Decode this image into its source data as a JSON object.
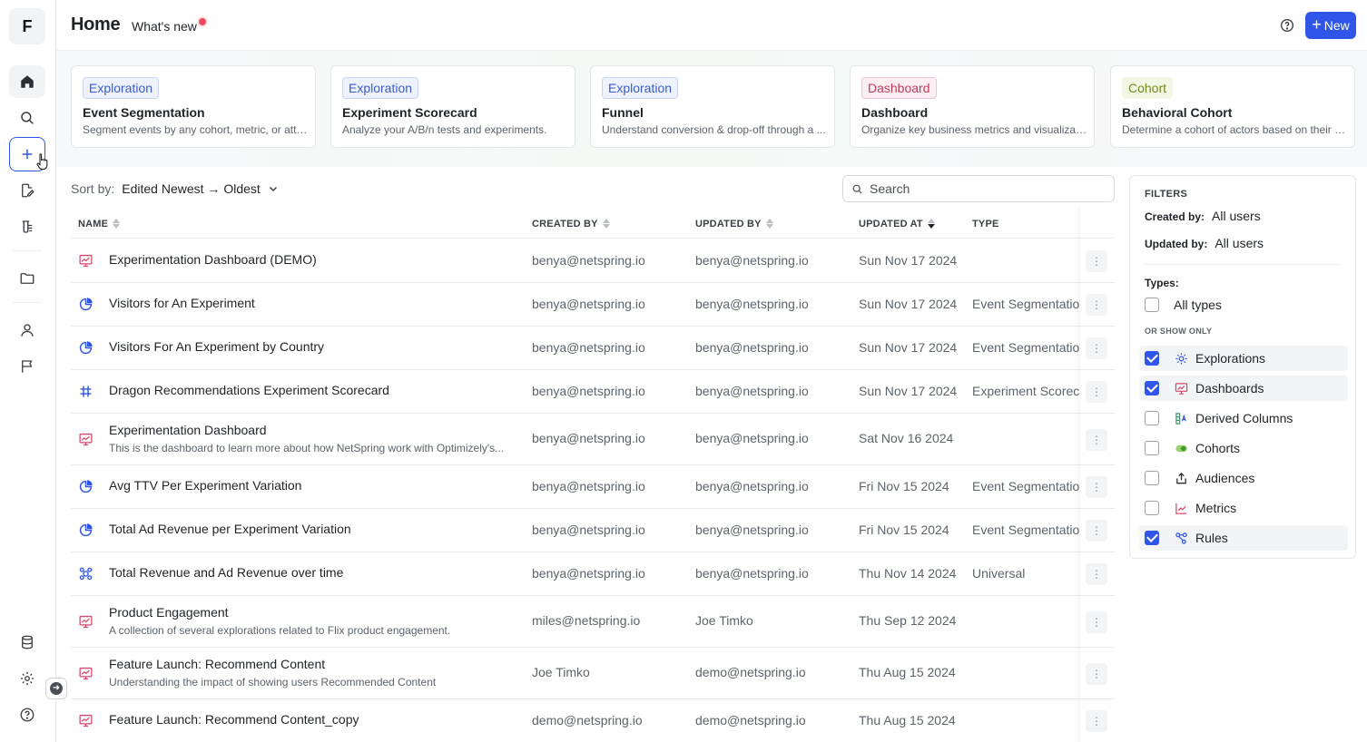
{
  "rail": {
    "logo": "F",
    "items": [
      {
        "name": "home-icon"
      },
      {
        "name": "search-icon"
      },
      {
        "name": "plus-icon"
      },
      {
        "name": "edit-doc-icon"
      },
      {
        "name": "flask-icon"
      },
      {
        "name": "folder-icon"
      },
      {
        "name": "user-icon"
      },
      {
        "name": "flag-icon"
      },
      {
        "name": "database-icon"
      },
      {
        "name": "gear-icon"
      },
      {
        "name": "help-icon"
      }
    ],
    "collapse_icon": "arrow-right-icon"
  },
  "header": {
    "title": "Home",
    "whats_new": "What's new",
    "new_button": "New"
  },
  "templates": [
    {
      "badge": "Exploration",
      "kind": "exp",
      "title": "Event Segmentation",
      "desc": "Segment events by any cohort, metric, or attri..."
    },
    {
      "badge": "Exploration",
      "kind": "exp",
      "title": "Experiment Scorecard",
      "desc": "Analyze your A/B/n tests and experiments."
    },
    {
      "badge": "Exploration",
      "kind": "exp",
      "title": "Funnel",
      "desc": "Understand conversion & drop-off through a ..."
    },
    {
      "badge": "Dashboard",
      "kind": "dash",
      "title": "Dashboard",
      "desc": "Organize key business metrics and visualizati..."
    },
    {
      "badge": "Cohort",
      "kind": "coh",
      "title": "Behavioral Cohort",
      "desc": "Determine a cohort of actors based on their a..."
    }
  ],
  "sort": {
    "label": "Sort by:",
    "value": "Edited Newest",
    "value2": "Oldest"
  },
  "search": {
    "placeholder": "Search"
  },
  "columns": {
    "name": "NAME",
    "created_by": "CREATED BY",
    "updated_by": "UPDATED BY",
    "updated_at": "UPDATED AT",
    "type": "TYPE"
  },
  "rows": [
    {
      "icon": "dashboard",
      "name": "Experimentation Dashboard (DEMO)",
      "desc": "",
      "created_by": "benya@netspring.io",
      "updated_by": "benya@netspring.io",
      "updated_at": "Sun Nov 17 2024",
      "type": ""
    },
    {
      "icon": "segmentation",
      "name": "Visitors for An Experiment",
      "desc": "",
      "created_by": "benya@netspring.io",
      "updated_by": "benya@netspring.io",
      "updated_at": "Sun Nov 17 2024",
      "type": "Event Segmentatior"
    },
    {
      "icon": "segmentation",
      "name": "Visitors For An Experiment by Country",
      "desc": "",
      "created_by": "benya@netspring.io",
      "updated_by": "benya@netspring.io",
      "updated_at": "Sun Nov 17 2024",
      "type": "Event Segmentatior"
    },
    {
      "icon": "scorecard",
      "name": "Dragon Recommendations Experiment Scorecard",
      "desc": "",
      "created_by": "benya@netspring.io",
      "updated_by": "benya@netspring.io",
      "updated_at": "Sun Nov 17 2024",
      "type": "Experiment Scoreca"
    },
    {
      "icon": "dashboard",
      "name": "Experimentation Dashboard",
      "desc": "This is the dashboard to learn more about how NetSpring work with Optimizely's...",
      "created_by": "benya@netspring.io",
      "updated_by": "benya@netspring.io",
      "updated_at": "Sat Nov 16 2024",
      "type": ""
    },
    {
      "icon": "segmentation",
      "name": "Avg TTV Per Experiment Variation",
      "desc": "",
      "created_by": "benya@netspring.io",
      "updated_by": "benya@netspring.io",
      "updated_at": "Fri Nov 15 2024",
      "type": "Event Segmentatior"
    },
    {
      "icon": "segmentation",
      "name": "Total Ad Revenue per Experiment Variation",
      "desc": "",
      "created_by": "benya@netspring.io",
      "updated_by": "benya@netspring.io",
      "updated_at": "Fri Nov 15 2024",
      "type": "Event Segmentatior"
    },
    {
      "icon": "universal",
      "name": "Total Revenue and Ad Revenue over time",
      "desc": "",
      "created_by": "benya@netspring.io",
      "updated_by": "benya@netspring.io",
      "updated_at": "Thu Nov 14 2024",
      "type": "Universal"
    },
    {
      "icon": "dashboard",
      "name": "Product Engagement",
      "desc": "A collection of several explorations related to Flix product engagement.",
      "created_by": "miles@netspring.io",
      "updated_by": "Joe Timko",
      "updated_at": "Thu Sep 12 2024",
      "type": ""
    },
    {
      "icon": "dashboard",
      "name": "Feature Launch: Recommend Content",
      "desc": "Understanding the impact of showing users Recommended Content",
      "created_by": "Joe Timko",
      "updated_by": "demo@netspring.io",
      "updated_at": "Thu Aug 15 2024",
      "type": ""
    },
    {
      "icon": "dashboard",
      "name": "Feature Launch: Recommend Content_copy",
      "desc": "",
      "created_by": "demo@netspring.io",
      "updated_by": "demo@netspring.io",
      "updated_at": "Thu Aug 15 2024",
      "type": ""
    }
  ],
  "filters": {
    "title": "FILTERS",
    "created_by_label": "Created by:",
    "created_by_value": "All users",
    "updated_by_label": "Updated by:",
    "updated_by_value": "All users",
    "types_label": "Types:",
    "all_types": "All types",
    "all_types_checked": false,
    "or_show_only": "OR SHOW ONLY",
    "options": [
      {
        "label": "Explorations",
        "checked": true,
        "icon": "explorations-icon"
      },
      {
        "label": "Dashboards",
        "checked": true,
        "icon": "dashboards-icon"
      },
      {
        "label": "Derived Columns",
        "checked": false,
        "icon": "derived-columns-icon"
      },
      {
        "label": "Cohorts",
        "checked": false,
        "icon": "cohorts-icon"
      },
      {
        "label": "Audiences",
        "checked": false,
        "icon": "audiences-icon"
      },
      {
        "label": "Metrics",
        "checked": false,
        "icon": "metrics-icon"
      },
      {
        "label": "Rules",
        "checked": true,
        "icon": "rules-icon"
      }
    ]
  },
  "colors": {
    "accent": "#2f56e8",
    "dashboard_icon": "#d9476b",
    "exploration_icon": "#2f56e8"
  }
}
